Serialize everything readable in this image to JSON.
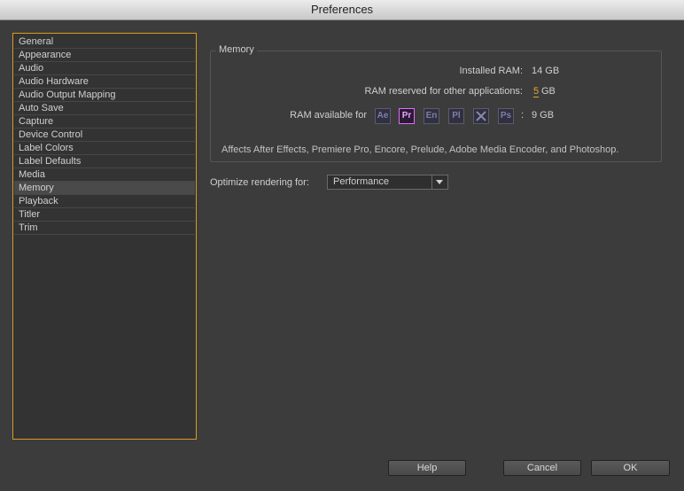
{
  "window": {
    "title": "Preferences"
  },
  "sidebar": {
    "items": [
      {
        "label": "General"
      },
      {
        "label": "Appearance"
      },
      {
        "label": "Audio"
      },
      {
        "label": "Audio Hardware"
      },
      {
        "label": "Audio Output Mapping"
      },
      {
        "label": "Auto Save"
      },
      {
        "label": "Capture"
      },
      {
        "label": "Device Control"
      },
      {
        "label": "Label Colors"
      },
      {
        "label": "Label Defaults"
      },
      {
        "label": "Media"
      },
      {
        "label": "Memory"
      },
      {
        "label": "Playback"
      },
      {
        "label": "Titler"
      },
      {
        "label": "Trim"
      }
    ],
    "selected": "Memory"
  },
  "memory": {
    "group_title": "Memory",
    "installed_label": "Installed RAM:",
    "installed_value": "14 GB",
    "reserved_label": "RAM reserved for other applications:",
    "reserved_value": "5",
    "reserved_unit": "GB",
    "available_label": "RAM available for",
    "apps": [
      {
        "code": "Ae",
        "icon": "after-effects-icon"
      },
      {
        "code": "Pr",
        "icon": "premiere-pro-icon",
        "active": true
      },
      {
        "code": "En",
        "icon": "encore-icon"
      },
      {
        "code": "Pl",
        "icon": "prelude-icon"
      },
      {
        "code": "",
        "icon": "media-encoder-icon"
      },
      {
        "code": "Ps",
        "icon": "photoshop-icon"
      }
    ],
    "available_sep": ":",
    "available_value": "9 GB",
    "note": "Affects After Effects, Premiere Pro, Encore, Prelude, Adobe Media Encoder, and Photoshop."
  },
  "optimize": {
    "label": "Optimize rendering for:",
    "value": "Performance"
  },
  "buttons": {
    "help": "Help",
    "cancel": "Cancel",
    "ok": "OK"
  },
  "colors": {
    "accent": "#d89b1e",
    "premiere": "#e06cff"
  }
}
